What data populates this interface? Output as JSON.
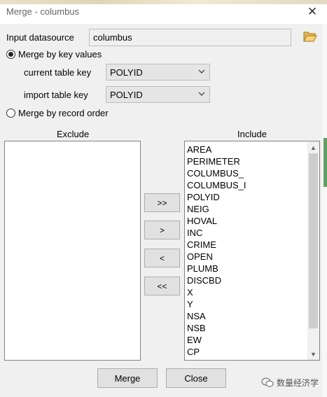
{
  "window": {
    "title": "Merge - columbus",
    "close_glyph": "✕"
  },
  "datasource": {
    "label": "Input datasource",
    "value": "columbus",
    "browse_icon": "folder-open-icon"
  },
  "merge_by_key": {
    "label": "Merge by key values",
    "selected": true
  },
  "current_key": {
    "label": "current table key",
    "value": "POLYID"
  },
  "import_key": {
    "label": "import table key",
    "value": "POLYID"
  },
  "merge_by_record": {
    "label": "Merge by record order",
    "selected": false
  },
  "exclude": {
    "header": "Exclude",
    "items": []
  },
  "include": {
    "header": "Include",
    "items": [
      "AREA",
      "PERIMETER",
      "COLUMBUS_",
      "COLUMBUS_I",
      "POLYID",
      "NEIG",
      "HOVAL",
      "INC",
      "CRIME",
      "OPEN",
      "PLUMB",
      "DISCBD",
      "X",
      "Y",
      "NSA",
      "NSB",
      "EW",
      "CP"
    ]
  },
  "move_buttons": {
    "all_right": ">>",
    "one_right": ">",
    "one_left": "<",
    "all_left": "<<"
  },
  "actions": {
    "merge": "Merge",
    "close": "Close"
  },
  "watermark": {
    "text": "数量经济学",
    "icon": "wechat-icon"
  }
}
